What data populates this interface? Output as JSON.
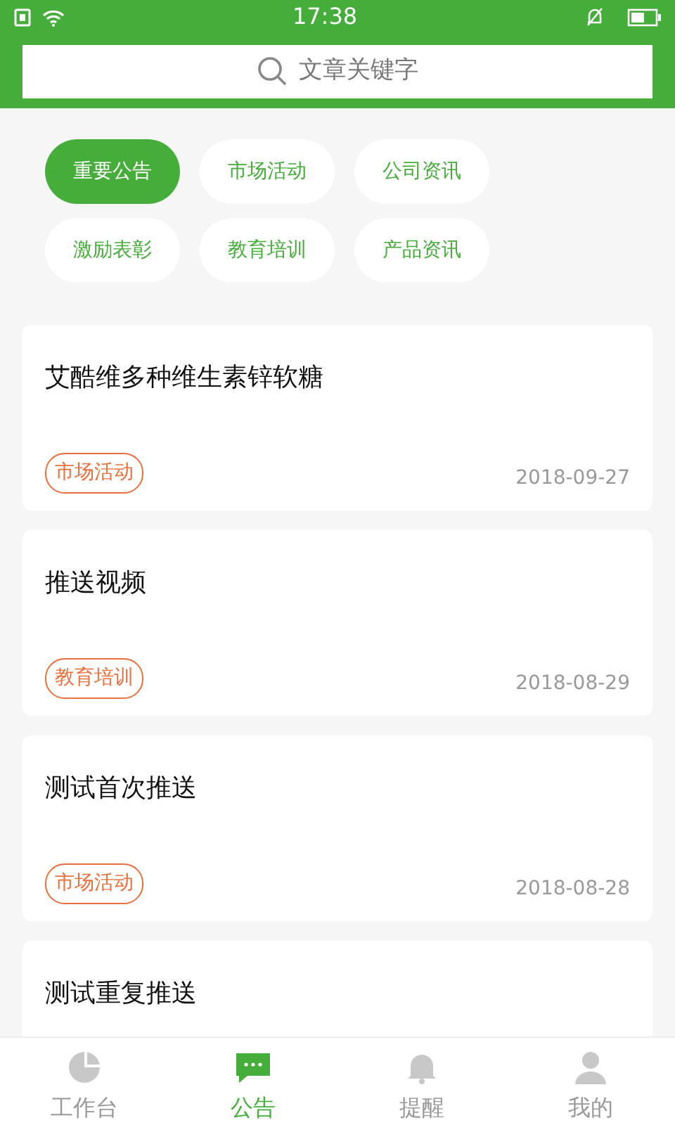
{
  "status_bar": {
    "time": "17:38"
  },
  "search": {
    "placeholder": "文章关键字"
  },
  "categories": [
    {
      "label": "重要公告",
      "selected": true
    },
    {
      "label": "市场活动",
      "selected": false
    },
    {
      "label": "公司资讯",
      "selected": false
    },
    {
      "label": "激励表彰",
      "selected": false
    },
    {
      "label": "教育培训",
      "selected": false
    },
    {
      "label": "产品资讯",
      "selected": false
    }
  ],
  "articles": [
    {
      "title": "艾酷维多种维生素锌软糖",
      "tag": "市场活动",
      "date": "2018-09-27"
    },
    {
      "title": "推送视频",
      "tag": "教育培训",
      "date": "2018-08-29"
    },
    {
      "title": "测试首次推送",
      "tag": "市场活动",
      "date": "2018-08-28"
    },
    {
      "title": "测试重复推送"
    }
  ],
  "tab_bar": [
    {
      "label": "工作台",
      "kind": "chart",
      "selected": false
    },
    {
      "label": "公告",
      "kind": "message",
      "selected": true
    },
    {
      "label": "提醒",
      "kind": "bell",
      "selected": false
    },
    {
      "label": "我的",
      "kind": "person",
      "selected": false
    }
  ]
}
